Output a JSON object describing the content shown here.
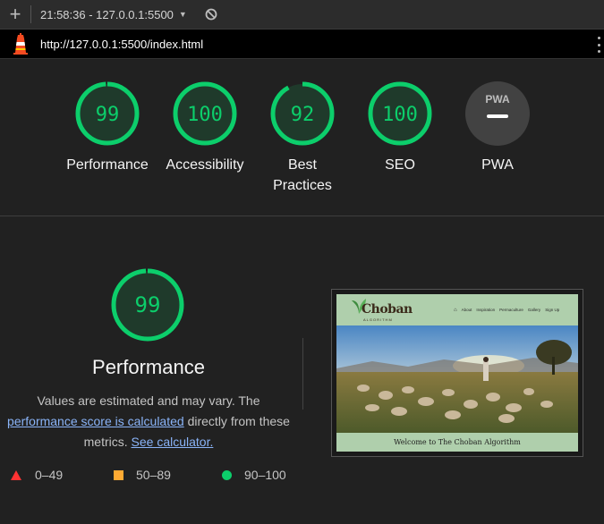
{
  "toolbar": {
    "plus_label": "+",
    "report_label": "21:58:36 - 127.0.0.1:5500"
  },
  "urlbar": {
    "url": "http://127.0.0.1:5500/index.html"
  },
  "scores": [
    {
      "label": "Performance",
      "value": "99",
      "fraction": 0.99
    },
    {
      "label": "Accessibility",
      "value": "100",
      "fraction": 1.0
    },
    {
      "label": "Best Practices",
      "value": "92",
      "fraction": 0.92
    },
    {
      "label": "SEO",
      "value": "100",
      "fraction": 1.0
    },
    {
      "label": "PWA",
      "badge": "PWA"
    }
  ],
  "performance": {
    "value": "99",
    "fraction": 0.99,
    "title": "Performance",
    "desc_before": "Values are estimated and may vary. The",
    "desc_link": "performance score is calculated",
    "desc_middle": "directly from these metrics.",
    "desc_link2": "See calculator."
  },
  "legend": [
    {
      "label": "0–49",
      "color": "#ff3333"
    },
    {
      "label": "50–89",
      "color": "#ffaa33"
    },
    {
      "label": "90–100",
      "color": "#0cce6b"
    }
  ],
  "thumbnail": {
    "brand": "Choban",
    "brand_sub": "ALGORITHM",
    "nav_links": [
      "About",
      "Inspiration",
      "Permaculture",
      "Gallery",
      "Sign Up"
    ],
    "footer": "Welcome to The Choban Algorithm"
  },
  "colors": {
    "pass": "#0cce6b",
    "gauge_bg": "#1f3a2b",
    "pwa_gray": "#424242"
  }
}
